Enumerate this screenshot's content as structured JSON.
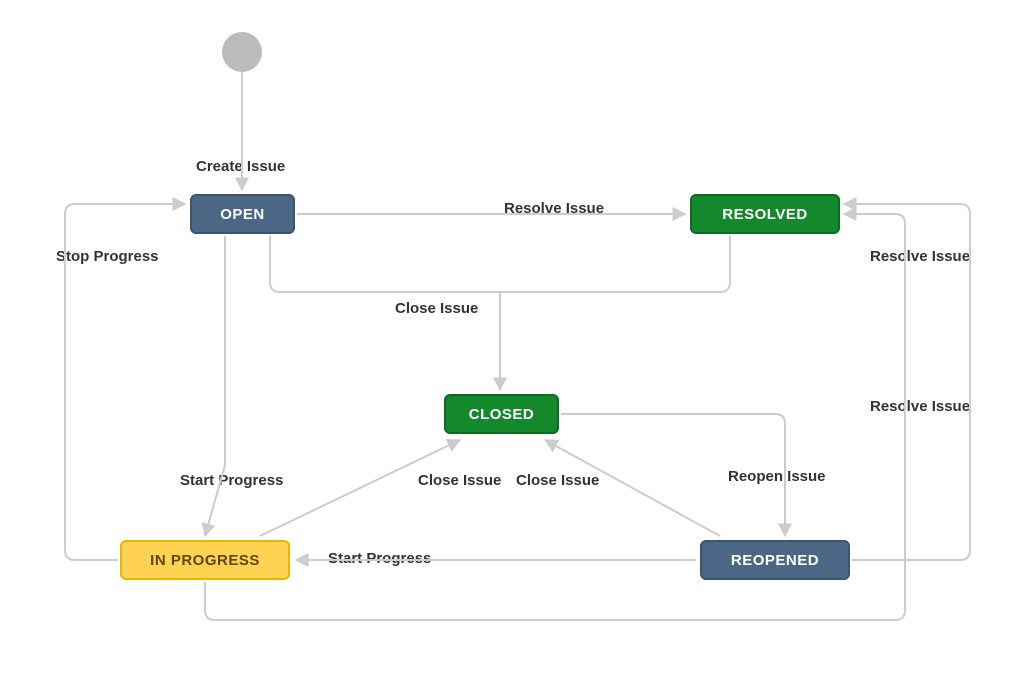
{
  "nodes": {
    "open": {
      "label": "OPEN"
    },
    "resolved": {
      "label": "RESOLVED"
    },
    "closed": {
      "label": "CLOSED"
    },
    "in_progress": {
      "label": "IN PROGRESS"
    },
    "reopened": {
      "label": "REOPENED"
    }
  },
  "edges": {
    "create_issue": {
      "label": "Create Issue"
    },
    "resolve_issue_top": {
      "label": "Resolve Issue"
    },
    "stop_progress": {
      "label": "Stop Progress"
    },
    "close_issue_top": {
      "label": "Close Issue"
    },
    "start_progress_left": {
      "label": "Start Progress"
    },
    "close_issue_left": {
      "label": "Close Issue"
    },
    "close_issue_right": {
      "label": "Close Issue"
    },
    "reopen_issue": {
      "label": "Reopen Issue"
    },
    "resolve_issue_mid": {
      "label": "Resolve Issue"
    },
    "resolve_issue_right": {
      "label": "Resolve Issue"
    },
    "start_progress_mid": {
      "label": "Start Progress"
    }
  },
  "colors": {
    "blue": "#4a6785",
    "green": "#14892c",
    "yellow": "#ffd351",
    "edge": "#cccccc",
    "text": "#333333"
  }
}
